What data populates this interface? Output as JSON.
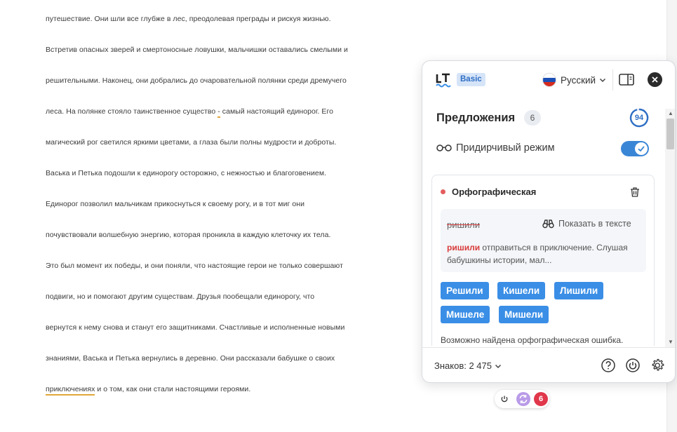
{
  "document": {
    "lines": [
      "путешествие. Они шли все глубже в лес, преодолевая преграды и рискуя жизнью.",
      "Встретив опасных зверей и смертоносные ловушки, мальчишки оставались смелыми и",
      "решительными. Наконец, они добрались до очаровательной полянки среди дремучего",
      {
        "before": "леса. На полянке стояло таинственное существо ",
        "flag": "-",
        "after": " самый настоящий единорог. Его"
      },
      "магический рог светился яркими цветами, а глаза были полны мудрости и доброты.",
      "Васька и Петька подошли к единорогу осторожно, с нежностью и благоговением.",
      "Единорог позволил мальчикам прикоснуться к своему рогу, и в тот миг они",
      "почувствовали волшебную энергию, которая проникла в каждую клеточку их тела.",
      "Это был момент их победы, и они поняли, что настоящие герои не только совершают",
      "подвиги, но и помогают другим существам. Друзья пообещали единорогу, что",
      "вернутся к нему снова и станут его защитниками. Счастливые и исполненные новыми",
      "знаниями, Васька и Петька вернулись в деревню. Они рассказали бабушке о своих",
      {
        "before": "",
        "flag": "приключениях",
        "after": " и о том, как они стали настоящими героями."
      }
    ]
  },
  "panel": {
    "plan_badge": "Basic",
    "language": "Русский",
    "suggestions_title": "Предложения",
    "suggestions_count": "6",
    "score": "94",
    "picky_mode_label": "Придирчивый режим",
    "picky_mode_on": true,
    "card": {
      "category": "Орфографическая",
      "error_word": "ришили",
      "show_in_text": "Показать в тексте",
      "context_highlight": "ришили",
      "context_rest": " отправиться в приключение. Слушая бабушкины истории, мал...",
      "suggestions": [
        "Решили",
        "Кишели",
        "Лишили",
        "Мишеле",
        "Мишели"
      ],
      "description": "Возможно найдена орфографическая ошибка."
    },
    "footer": {
      "chars_label": "Знаков: 2 475"
    }
  },
  "mini_widget": {
    "count": "6"
  },
  "colors": {
    "accent": "#3a8ee6",
    "error": "#d93b3b",
    "badge_red": "#e0374b",
    "underline": "#e0a63a"
  }
}
